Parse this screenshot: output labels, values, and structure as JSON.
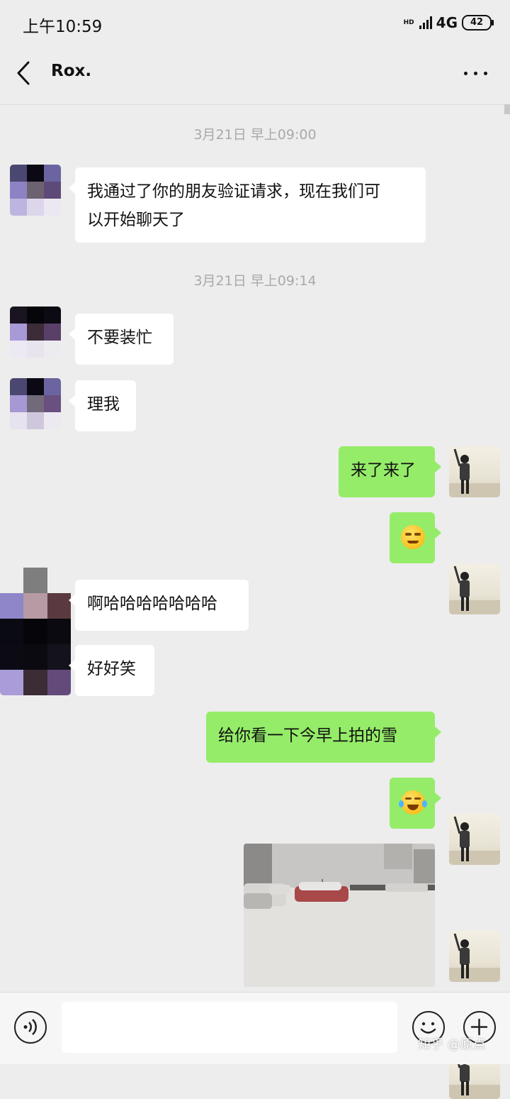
{
  "status_bar": {
    "time": "上午10:59",
    "hd_label": "HD",
    "network": "4G",
    "battery": "42"
  },
  "header": {
    "title": "Rox."
  },
  "timestamps": [
    "3月21日 早上09:00",
    "3月21日 早上09:14"
  ],
  "messages": [
    {
      "from": "contact",
      "lines": [
        "我通过了你的朋友验证请求，现在我们可",
        "以开始聊天了"
      ]
    },
    {
      "from": "contact",
      "text": "不要装忙"
    },
    {
      "from": "contact",
      "text": "理我"
    },
    {
      "from": "me",
      "text": "来了来了"
    },
    {
      "from": "me",
      "emoji": "smirk-emoji"
    },
    {
      "from": "contact",
      "text": "啊哈哈哈哈哈哈哈"
    },
    {
      "from": "contact",
      "text": "好好笑"
    },
    {
      "from": "me",
      "text": "给你看一下今早上拍的雪"
    },
    {
      "from": "me",
      "emoji": "tears-of-joy-emoji"
    },
    {
      "from": "me",
      "image": "snow-photo"
    }
  ],
  "watermark": "知乎 @原点",
  "colors": {
    "background": "#ededed",
    "outgoing_bubble": "#95ec69",
    "incoming_bubble": "#ffffff",
    "timestamp": "#a9a9a9"
  }
}
